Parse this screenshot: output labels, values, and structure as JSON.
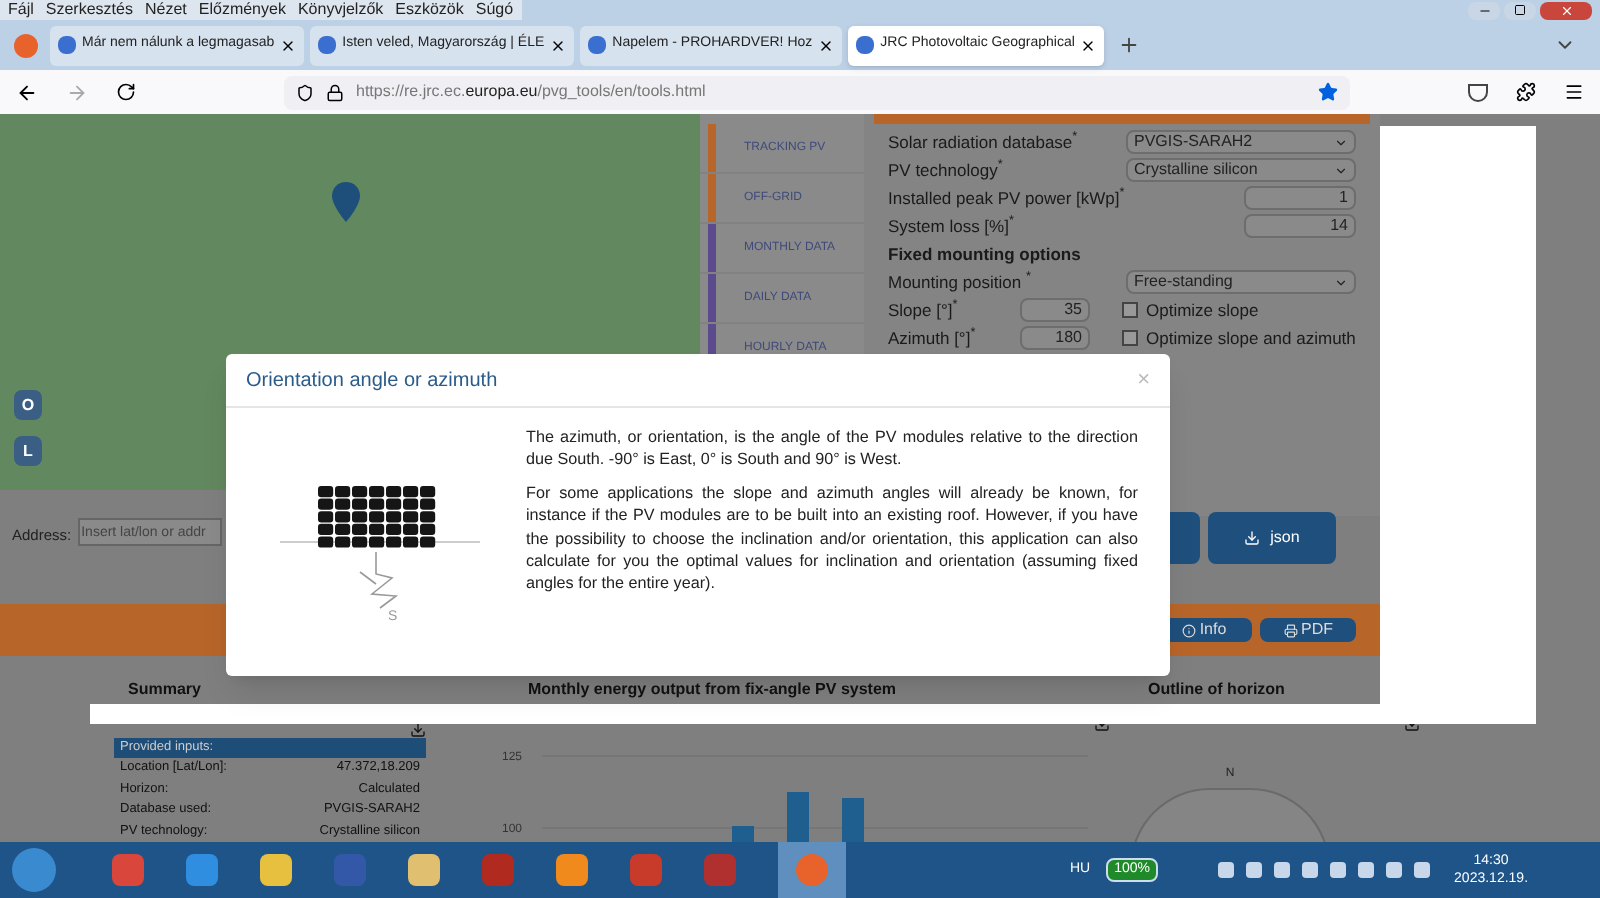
{
  "menu": [
    "Fájl",
    "Szerkesztés",
    "Nézet",
    "Előzmények",
    "Könyvjelzők",
    "Eszközök",
    "Súgó"
  ],
  "tabs": [
    {
      "title": "Már nem nálunk a legmagasab",
      "selected": false
    },
    {
      "title": "Isten veled, Magyarország | ÉLE",
      "selected": false
    },
    {
      "title": "Napelem - PROHARDVER! Hoz",
      "selected": false
    },
    {
      "title": "JRC Photovoltaic Geographical",
      "selected": true
    }
  ],
  "address_bar": {
    "url": "https://re.jrc.ec.**europa.eu**/pvg_tools/en/tools.html",
    "bookmarked": true
  },
  "map": {
    "layer_buttons": [
      "O",
      "L"
    ]
  },
  "side_nav": [
    {
      "label": "TRACKING PV",
      "color": "#b8652a"
    },
    {
      "label": "OFF-GRID",
      "color": "#b8652a"
    },
    {
      "label": "MONTHLY DATA",
      "color": "#5b4a8c"
    },
    {
      "label": "DAILY DATA",
      "color": "#5b4a8c"
    },
    {
      "label": "HOURLY DATA",
      "color": "#5b4a8c"
    }
  ],
  "form": [
    {
      "kind": "select",
      "label": "Solar radiation database$^{*}$",
      "value": "PVGIS-SARAH2"
    },
    {
      "kind": "select",
      "label": "PV technology$^{*}$",
      "value": "Crystalline silicon"
    },
    {
      "kind": "input",
      "label": "Installed peak PV power [kWp]$^{*}$",
      "value": "1"
    },
    {
      "kind": "input",
      "label": "System loss [%]$^{*}$",
      "value": "14"
    },
    {
      "kind": "heading",
      "label": "Fixed mounting options"
    },
    {
      "kind": "select",
      "label": "Mounting position $^{*}$",
      "value": "Free-standing"
    },
    {
      "kind": "input_check",
      "label": "Slope [°]$^{*}$",
      "value": "35",
      "check_label": "Optimize slope",
      "checked": false
    },
    {
      "kind": "input_check",
      "label": "Azimuth [°]$^{*}$",
      "value": "180",
      "check_label": "Optimize slope and azimuth",
      "checked": false
    }
  ],
  "address": {
    "label": "Address:",
    "placeholder": "Insert lat/lon or addr"
  },
  "export_buttons": [
    {
      "label": "json"
    }
  ],
  "result_bar": {
    "buttons": [
      {
        "kind": "info",
        "label": "Info"
      },
      {
        "kind": "pdf",
        "label": "PDF"
      }
    ]
  },
  "panels": [
    {
      "title": "Summary"
    },
    {
      "title": "Monthly energy output from fix-angle PV system"
    },
    {
      "title": "Outline of horizon"
    }
  ],
  "summary": {
    "header": "Provided inputs:",
    "rows": [
      [
        "Location [Lat/Lon]:",
        "47.372,18.209"
      ],
      [
        "Horizon:",
        "Calculated"
      ],
      [
        "Database used:",
        "PVGIS-SARAH2"
      ],
      [
        "PV technology:",
        "Crystalline silicon"
      ]
    ]
  },
  "chart": {
    "tick_labels": [
      "125",
      "100"
    ]
  },
  "horizon": {
    "label": "N"
  },
  "modal": {
    "title": "Orientation angle or azimuth",
    "close": "×",
    "compass_label": "S",
    "paragraphs": [
      "The azimuth, or orientation, is the angle of the PV modules relative to the direction due South. -90° is East, 0° is South and 90° is West.",
      "For some applications the slope and azimuth angles will already be known, for instance if the PV modules are to be built into an existing roof. However, if you have the possibility to choose the inclination and/or orientation, this application can also calculate for you the optimal values for inclination and orientation (assuming fixed angles for the entire year)."
    ]
  },
  "taskbar": {
    "language": "HU",
    "battery": "100%",
    "time": "14:30",
    "date": "2023.12.19."
  }
}
